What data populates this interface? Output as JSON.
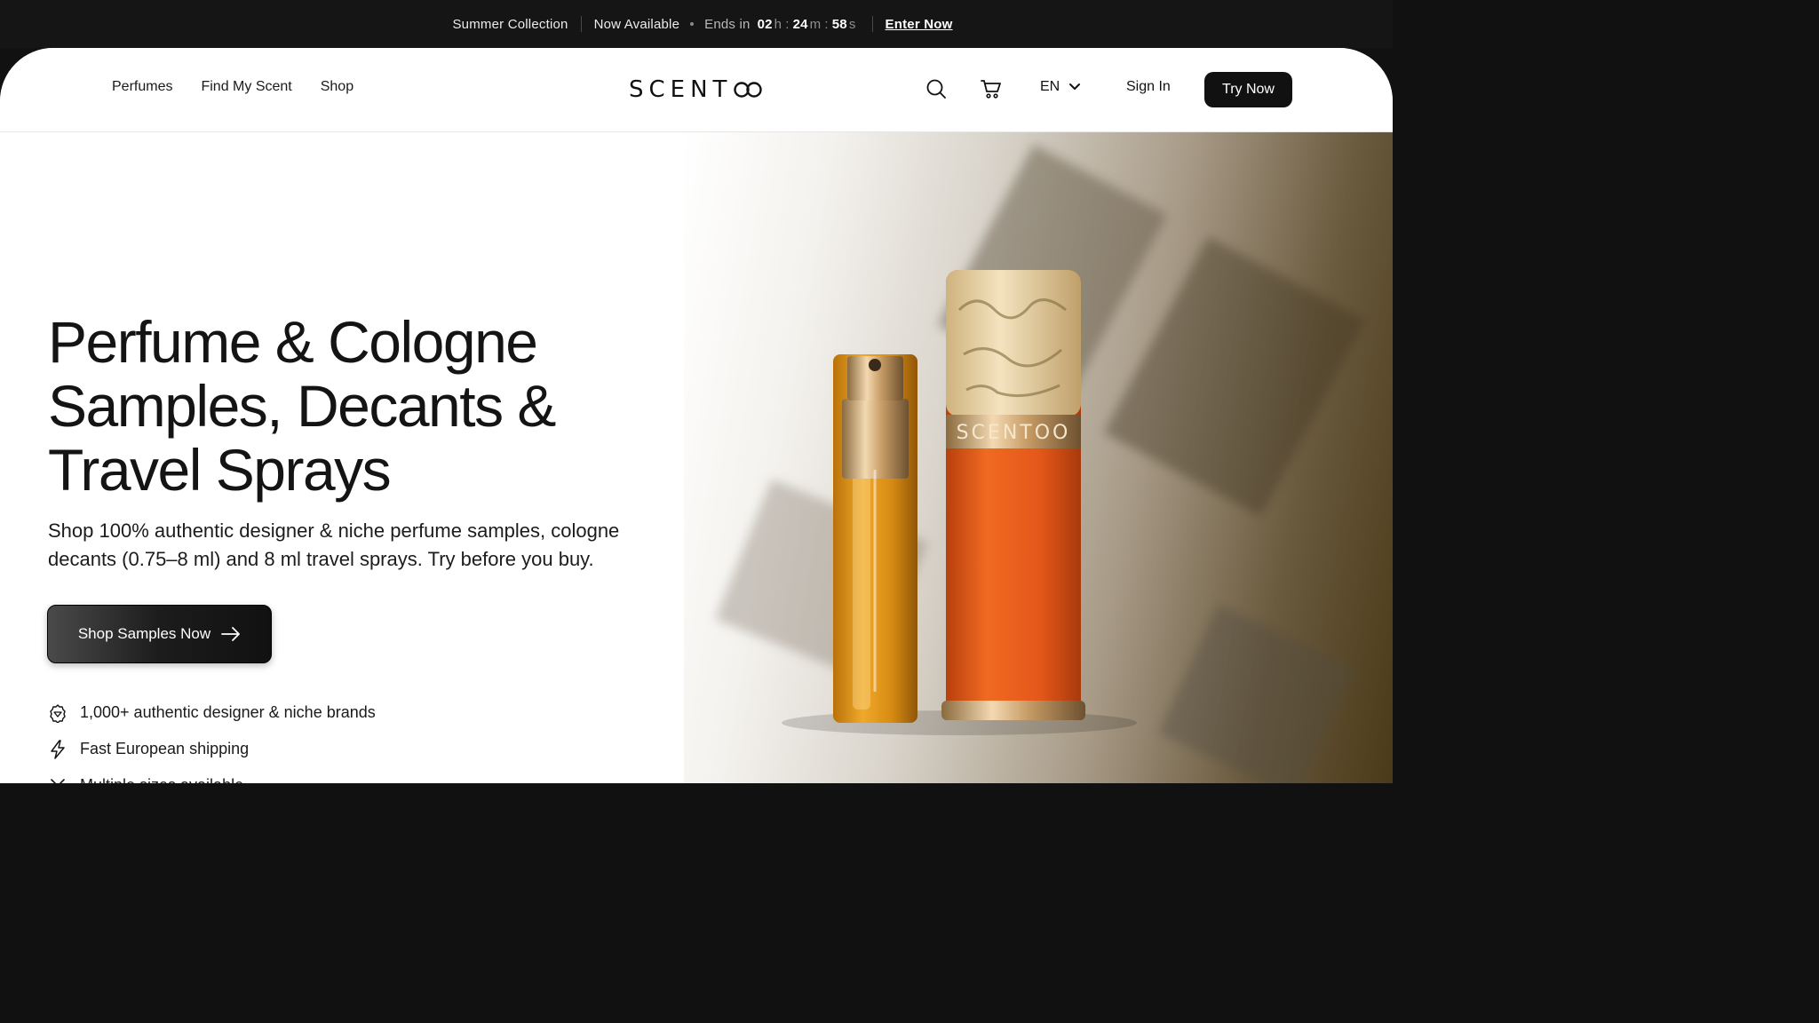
{
  "announcement": {
    "collection": "Summer Collection",
    "status": "Now Available",
    "ends_label": "Ends in",
    "hours": "02",
    "hours_unit": "h",
    "minutes": "24",
    "minutes_unit": "m",
    "seconds": "58",
    "seconds_unit": "s",
    "cta": "Enter Now"
  },
  "header": {
    "nav": [
      "Perfumes",
      "Find My Scent",
      "Shop"
    ],
    "logo_text": "SCENT",
    "language": "EN",
    "sign_in": "Sign In",
    "try_now": "Try Now",
    "icons": [
      "search-icon",
      "cart-icon",
      "chevron-down-icon"
    ]
  },
  "hero": {
    "headline_line1": "Perfume & Cologne",
    "headline_line2": "Samples, Decants &",
    "headline_line3": "Travel Sprays",
    "subtitle": "Shop 100% authentic designer & niche perfume samples, cologne decants (0.75–8 ml) and 8 ml travel sprays. Try before you buy.",
    "cta": "Shop Samples Now",
    "product_label": "SCENTOO",
    "features": [
      {
        "icon": "badge-icon",
        "text": "1,000+ authentic designer & niche brands"
      },
      {
        "icon": "bolt-icon",
        "text": "Fast European shipping"
      },
      {
        "icon": "sizes-icon",
        "text": "Multiple sizes available"
      }
    ]
  },
  "colors": {
    "dark": "#111111",
    "atomizer_orange": "#E4571A",
    "gold": "#C9A06A",
    "amber": "#D98A12"
  }
}
